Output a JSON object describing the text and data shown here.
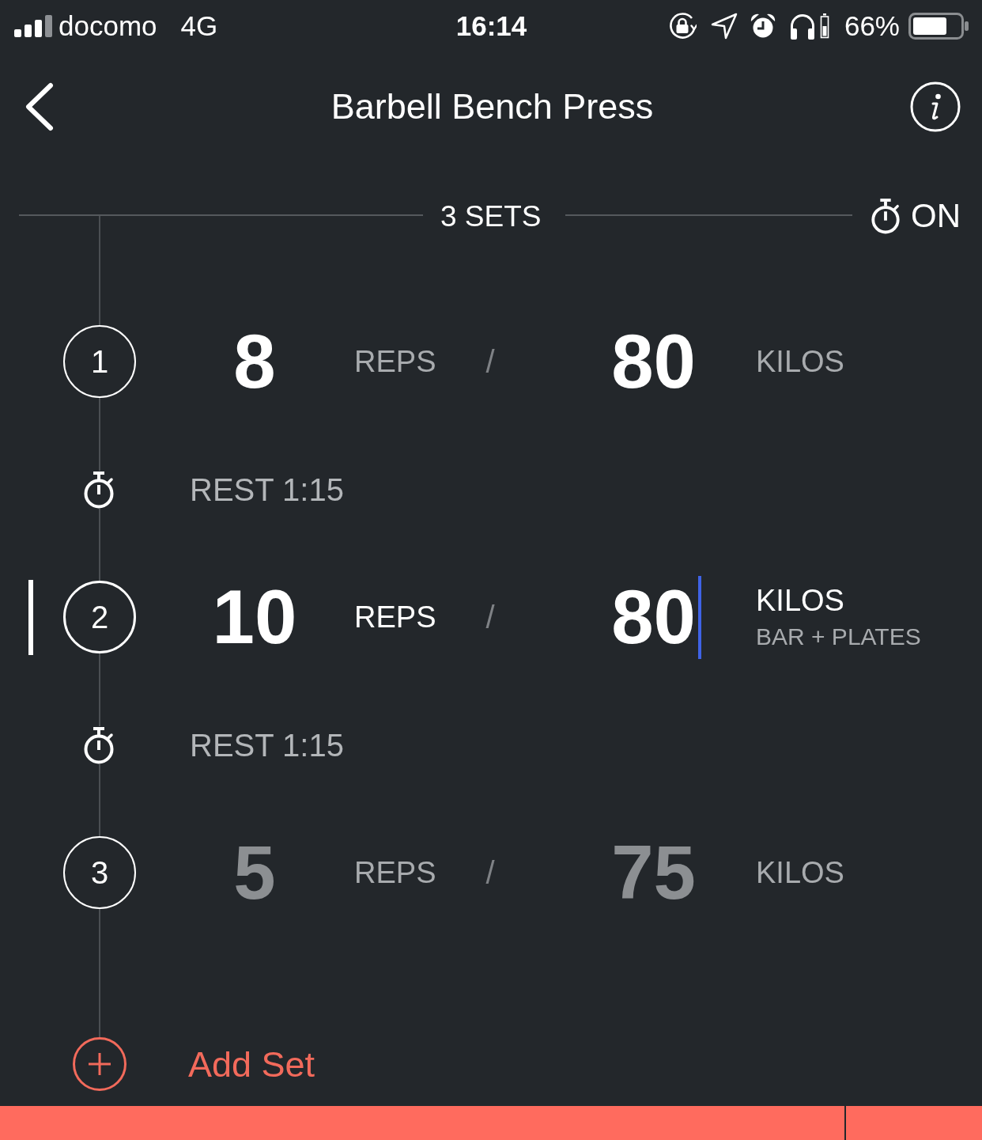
{
  "status_bar": {
    "carrier": "docomo",
    "network": "4G",
    "time": "16:14",
    "battery": "66%"
  },
  "nav": {
    "title": "Barbell Bench Press"
  },
  "sets_header": {
    "label": "3 SETS",
    "timer": "ON"
  },
  "timeline": [
    {
      "kind": "set",
      "number": "1",
      "reps": "8",
      "reps_unit": "REPS",
      "separator": "/",
      "weight": "80",
      "weight_unit": "KILOS",
      "selected": false,
      "entered": true
    },
    {
      "kind": "rest",
      "label": "REST 1:15"
    },
    {
      "kind": "set",
      "number": "2",
      "reps": "10",
      "reps_unit": "REPS",
      "separator": "/",
      "weight": "80",
      "weight_unit": "KILOS",
      "weight_note": "BAR + PLATES",
      "selected": true,
      "entered": true
    },
    {
      "kind": "rest",
      "label": "REST 1:15"
    },
    {
      "kind": "set",
      "number": "3",
      "reps": "5",
      "reps_unit": "REPS",
      "separator": "/",
      "weight": "75",
      "weight_unit": "KILOS",
      "selected": false,
      "entered": false
    }
  ],
  "add_set": {
    "label": "Add Set"
  }
}
